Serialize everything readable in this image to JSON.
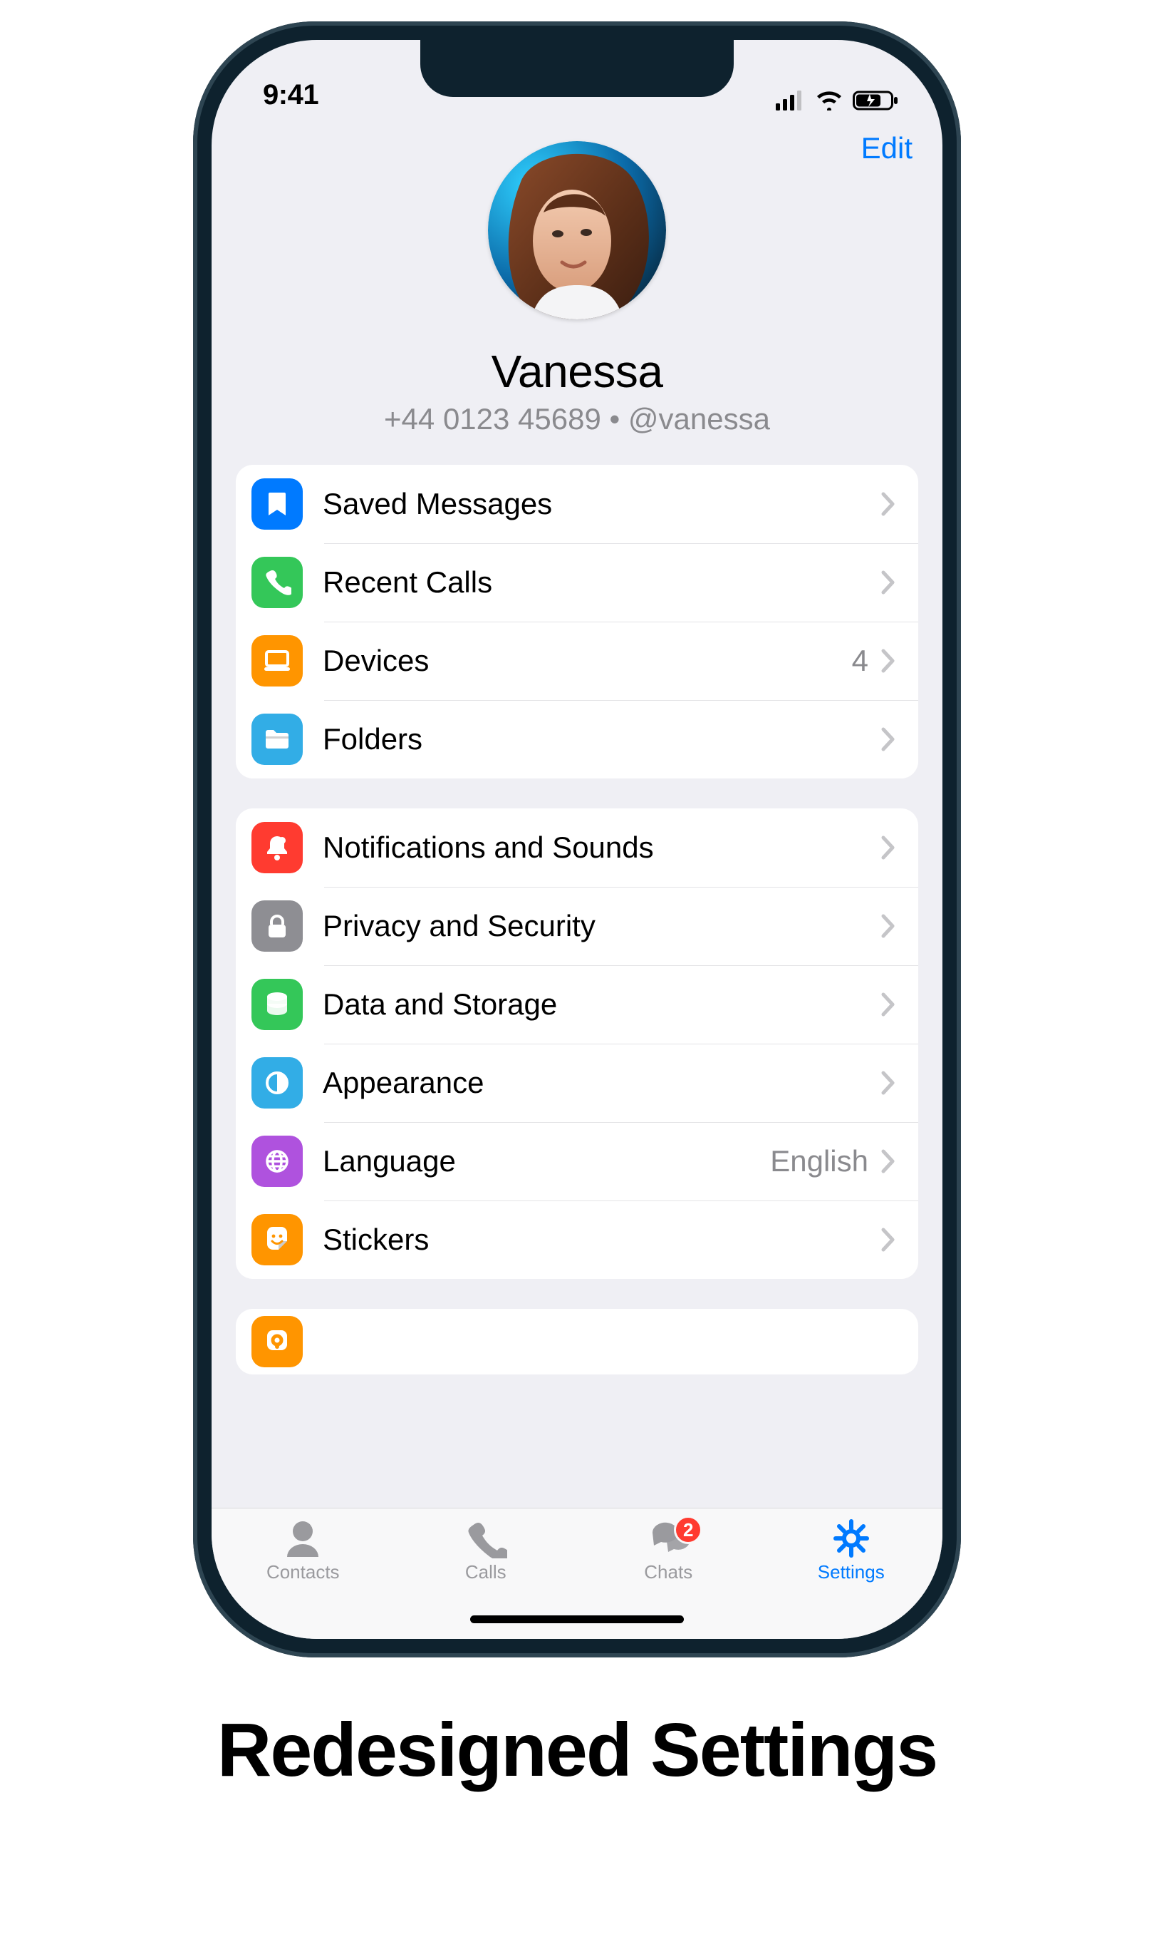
{
  "status": {
    "time": "9:41"
  },
  "header": {
    "edit_label": "Edit",
    "name": "Vanessa",
    "subline": "+44 0123 45689 • @vanessa"
  },
  "groups": [
    {
      "rows": [
        {
          "key": "saved-messages",
          "icon": "bookmark-icon",
          "color": "#007aff",
          "label": "Saved Messages",
          "value": ""
        },
        {
          "key": "recent-calls",
          "icon": "phone-icon",
          "color": "#34c759",
          "label": "Recent Calls",
          "value": ""
        },
        {
          "key": "devices",
          "icon": "laptop-icon",
          "color": "#ff9500",
          "label": "Devices",
          "value": "4"
        },
        {
          "key": "folders",
          "icon": "folder-icon",
          "color": "#32ade6",
          "label": "Folders",
          "value": ""
        }
      ]
    },
    {
      "rows": [
        {
          "key": "notifications",
          "icon": "bell-icon",
          "color": "#ff3b30",
          "label": "Notifications and Sounds",
          "value": ""
        },
        {
          "key": "privacy",
          "icon": "lock-icon",
          "color": "#8e8e93",
          "label": "Privacy and Security",
          "value": ""
        },
        {
          "key": "data-storage",
          "icon": "database-icon",
          "color": "#34c759",
          "label": "Data and Storage",
          "value": ""
        },
        {
          "key": "appearance",
          "icon": "contrast-icon",
          "color": "#32ade6",
          "label": "Appearance",
          "value": ""
        },
        {
          "key": "language",
          "icon": "globe-icon",
          "color": "#af52de",
          "label": "Language",
          "value": "English"
        },
        {
          "key": "stickers",
          "icon": "sticker-icon",
          "color": "#ff9500",
          "label": "Stickers",
          "value": ""
        }
      ]
    }
  ],
  "tabbar": {
    "items": [
      {
        "key": "contacts",
        "label": "Contacts",
        "active": false,
        "badge": ""
      },
      {
        "key": "calls",
        "label": "Calls",
        "active": false,
        "badge": ""
      },
      {
        "key": "chats",
        "label": "Chats",
        "active": false,
        "badge": "2"
      },
      {
        "key": "settings",
        "label": "Settings",
        "active": true,
        "badge": ""
      }
    ]
  },
  "caption": "Redesigned Settings"
}
